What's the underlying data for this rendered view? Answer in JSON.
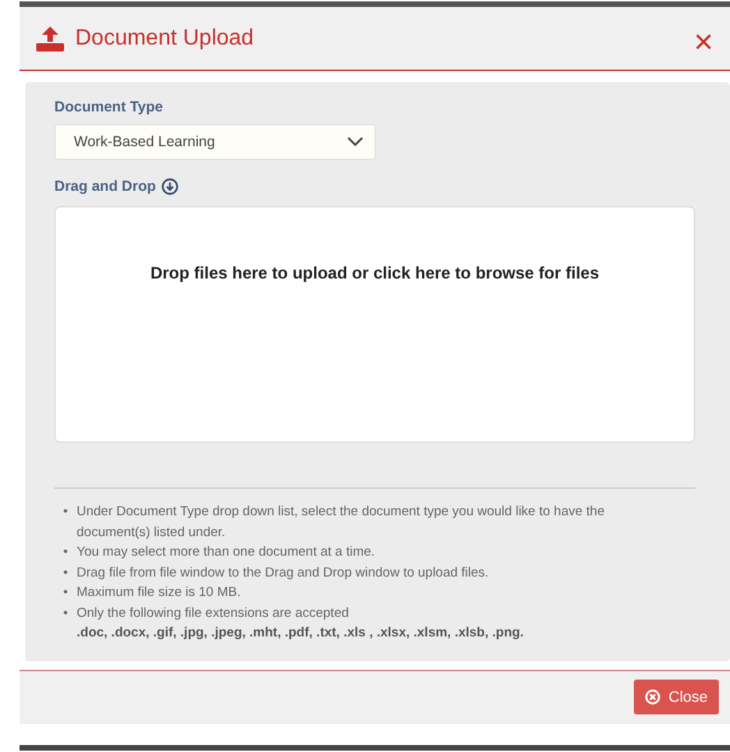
{
  "dialog": {
    "title": "Document Upload",
    "close_icon": "×"
  },
  "document_type": {
    "label": "Document Type",
    "value": "Work-Based Learning"
  },
  "drop_zone": {
    "label": "Drag and Drop",
    "message": "Drop files here to upload or click here to browse for files"
  },
  "instructions": [
    {
      "bullet": "•",
      "text": "Under Document Type drop down list, select the document type you would like to have the document(s) listed under."
    },
    {
      "bullet": "•",
      "text": "You may select more than one document at a time."
    },
    {
      "bullet": "•",
      "text": "Drag file from file window to the Drag and Drop window to upload files."
    },
    {
      "bullet": "•",
      "text": "Maximum file size is 10 MB."
    },
    {
      "bullet": "•",
      "text": "Only the following file extensions are accepted",
      "extensions": ".doc, .docx, .gif, .jpg, .jpeg, .mht, .pdf, .txt, .xls , .xlsx, .xlsm, .xlsb, .png."
    }
  ],
  "footer": {
    "button": "Close"
  }
}
